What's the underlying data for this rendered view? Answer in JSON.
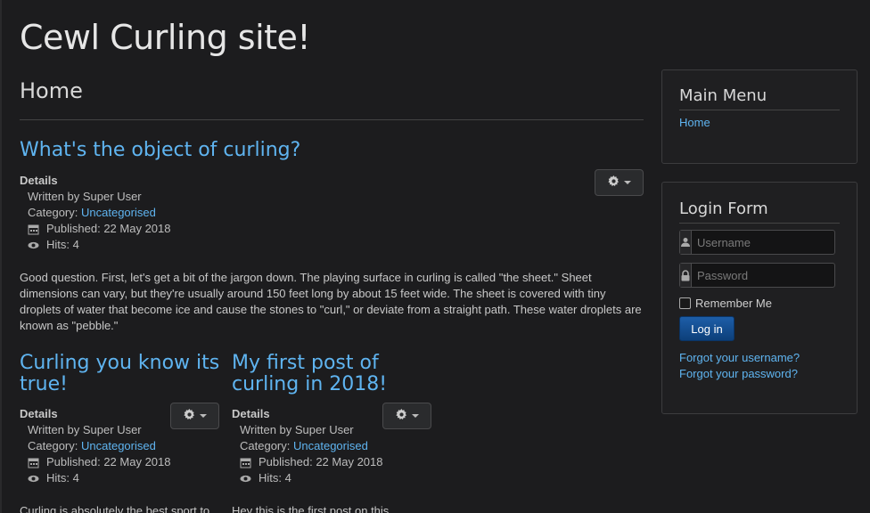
{
  "site": {
    "title": "Cewl Curling site!"
  },
  "page": {
    "heading": "Home"
  },
  "articles": [
    {
      "title": "What's the object of curling?",
      "details_label": "Details",
      "written_by": "Written by Super User",
      "category_label": "Category: ",
      "category": "Uncategorised",
      "published": "Published: 22 May 2018",
      "hits": "Hits: 4",
      "body": "Good question. First, let's get a bit of the jargon down. The playing surface in curling is called \"the sheet.\" Sheet dimensions can vary, but they're usually around 150 feet long by about 15 feet wide. The sheet is covered with tiny droplets of water that become ice and cause the stones to \"curl,\" or deviate from a straight path. These water droplets are known as \"pebble.\""
    },
    {
      "title": "Curling you know its true!",
      "details_label": "Details",
      "written_by": "Written by Super User",
      "category_label": "Category: ",
      "category": "Uncategorised",
      "published": "Published: 22 May 2018",
      "hits": "Hits: 4",
      "body": "Curling is absolutely the best sport to"
    },
    {
      "title": "My first post of curling in 2018!",
      "details_label": "Details",
      "written_by": "Written by Super User",
      "category_label": "Category: ",
      "category": "Uncategorised",
      "published": "Published: 22 May 2018",
      "hits": "Hits: 4",
      "body": "Hey this is the first post on this"
    }
  ],
  "main_menu": {
    "title": "Main Menu",
    "items": [
      {
        "label": "Home"
      }
    ]
  },
  "login_form": {
    "title": "Login Form",
    "username_placeholder": "Username",
    "password_placeholder": "Password",
    "remember_label": "Remember Me",
    "login_button": "Log in",
    "forgot_username": "Forgot your username?",
    "forgot_password": "Forgot your password?"
  },
  "icons": {
    "settings": "gear-icon",
    "calendar": "calendar-icon",
    "hits": "eye-icon",
    "user": "user-icon",
    "lock": "lock-icon"
  },
  "colors": {
    "link": "#5fb4f0",
    "background": "#1c1c1e",
    "button": "#1d5ea8"
  }
}
